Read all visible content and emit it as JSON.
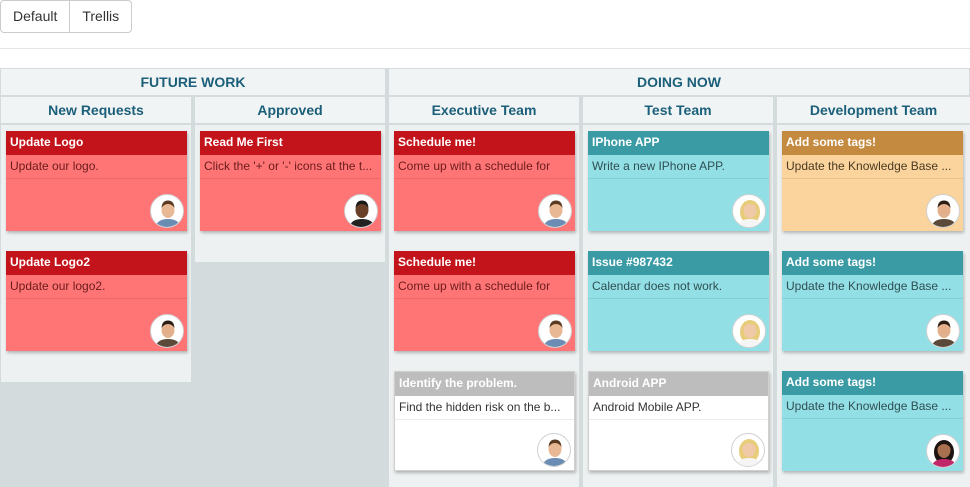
{
  "toolbar": {
    "default_label": "Default",
    "trellis_label": "Trellis"
  },
  "groups": [
    {
      "title": "FUTURE WORK"
    },
    {
      "title": "DOING NOW"
    }
  ],
  "columns": [
    {
      "title": "New Requests"
    },
    {
      "title": "Approved"
    },
    {
      "title": "Executive Team"
    },
    {
      "title": "Test Team"
    },
    {
      "title": "Development Team"
    }
  ],
  "cards": [
    {
      "title": "Update Logo",
      "desc": "Update our logo.",
      "color": "red",
      "avatar": "man-short-hair"
    },
    {
      "title": "Update Logo2",
      "desc": "Update our logo2.",
      "color": "red",
      "avatar": "man-dark-hair"
    },
    {
      "title": "Read Me First",
      "desc": "Click the '+' or '-' icons at the t...",
      "color": "red",
      "avatar": "man-dark-skin"
    },
    {
      "title": "Schedule me!",
      "desc": "Come up with a schedule for",
      "color": "red",
      "avatar": "man-short-hair"
    },
    {
      "title": "Schedule me!",
      "desc": "Come up with a schedule for",
      "color": "red",
      "avatar": "man-short-hair"
    },
    {
      "title": "Identify the problem.",
      "desc": "Find the hidden risk on the b...",
      "color": "gray",
      "avatar": "man-short-hair"
    },
    {
      "title": "IPhone APP",
      "desc": "Write a new IPhone APP.",
      "color": "teal",
      "avatar": "woman-blonde"
    },
    {
      "title": "Issue #987432",
      "desc": "Calendar does not work.",
      "color": "teal",
      "avatar": "woman-blonde"
    },
    {
      "title": "Android APP",
      "desc": "Android Mobile APP.",
      "color": "gray",
      "avatar": "woman-blonde"
    },
    {
      "title": "Add some tags!",
      "desc": "Update the Knowledge Base ...",
      "color": "orange",
      "avatar": "man-dark-hair"
    },
    {
      "title": "Add some tags!",
      "desc": "Update the Knowledge Base ...",
      "color": "teal",
      "avatar": "man-dark-hair"
    },
    {
      "title": "Add some tags!",
      "desc": "Update the Knowledge Base ...",
      "color": "teal",
      "avatar": "woman-dark-hair"
    }
  ],
  "colors": {
    "red_title": "#c4141b",
    "red_body": "#ff7576",
    "teal_title": "#3a9ba5",
    "teal_body": "#93dfe6",
    "orange_title": "#c48a3f",
    "orange_body": "#fbd39c",
    "gray_title": "#bdbdbd",
    "header_text": "#1b5f7a"
  }
}
